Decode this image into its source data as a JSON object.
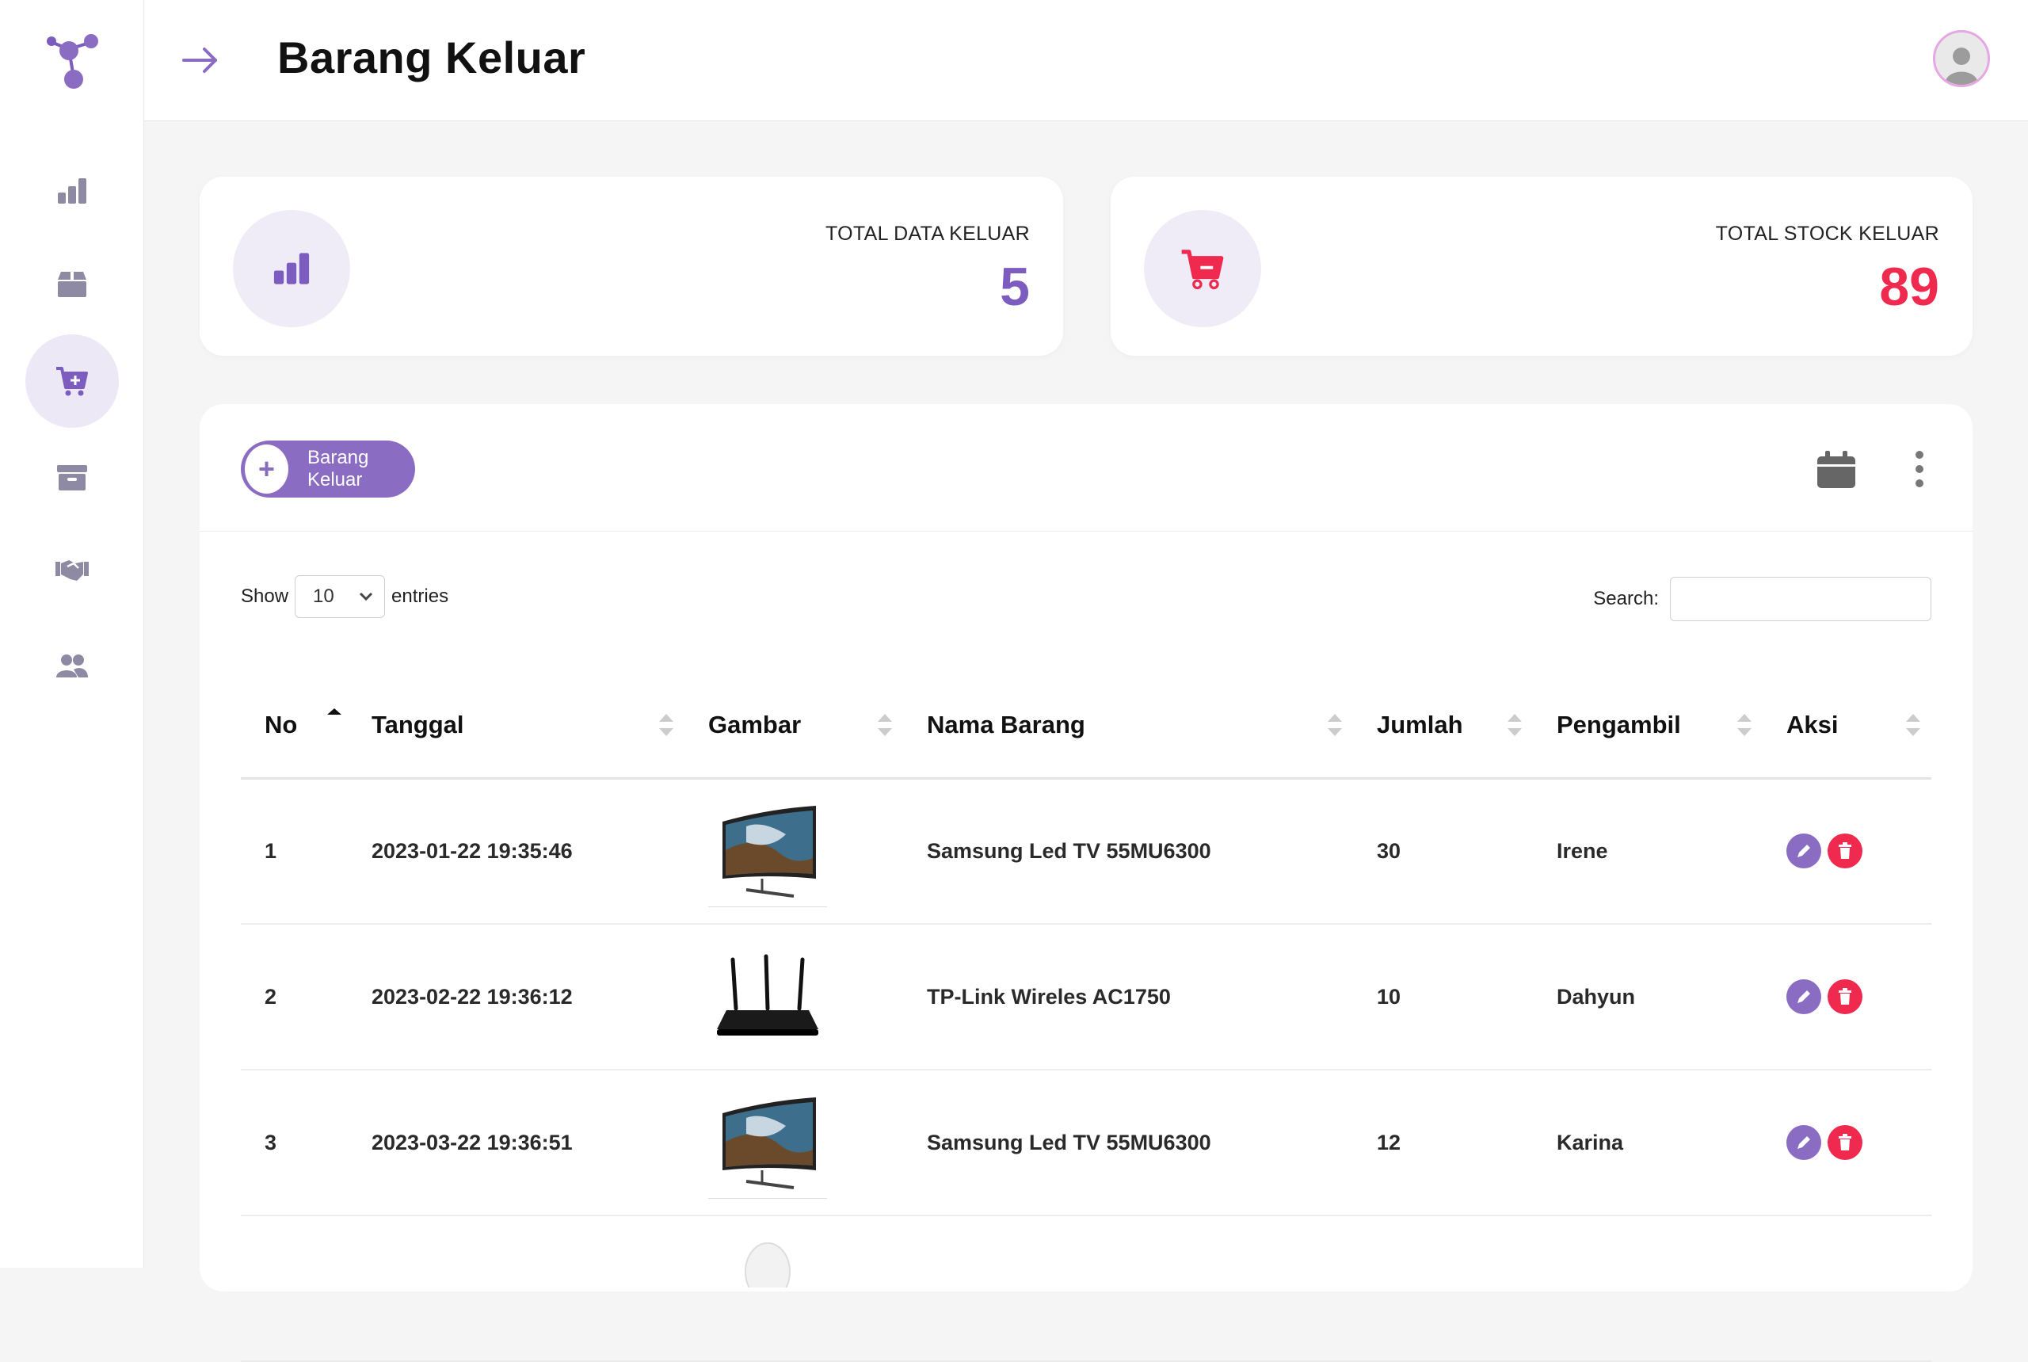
{
  "header": {
    "title": "Barang Keluar"
  },
  "sidebar": {
    "items": [
      {
        "icon": "chart-bar-icon"
      },
      {
        "icon": "box-icon"
      },
      {
        "icon": "cart-plus-icon",
        "active": true
      },
      {
        "icon": "archive-icon"
      },
      {
        "icon": "handshake-icon"
      },
      {
        "icon": "users-icon"
      }
    ]
  },
  "stats": [
    {
      "label": "TOTAL DATA KELUAR",
      "value": "5",
      "color": "#7c5cbf",
      "icon": "chart-bar-icon"
    },
    {
      "label": "TOTAL STOCK KELUAR",
      "value": "89",
      "color": "#ef2a4e",
      "icon": "cart-minus-icon"
    }
  ],
  "toolbar": {
    "add_label": "Barang Keluar",
    "add_symbol": "+"
  },
  "table_controls": {
    "show_label": "Show",
    "entries_value": "10",
    "entries_label": "entries",
    "search_label": "Search:",
    "search_value": ""
  },
  "table": {
    "columns": [
      "No",
      "Tanggal",
      "Gambar",
      "Nama Barang",
      "Jumlah",
      "Pengambil",
      "Aksi"
    ],
    "rows": [
      {
        "no": "1",
        "tanggal": "2023-01-22 19:35:46",
        "gambar": "tv",
        "nama": "Samsung Led TV 55MU6300",
        "jumlah": "30",
        "pengambil": "Irene"
      },
      {
        "no": "2",
        "tanggal": "2023-02-22 19:36:12",
        "gambar": "router",
        "nama": "TP-Link Wireles AC1750",
        "jumlah": "10",
        "pengambil": "Dahyun"
      },
      {
        "no": "3",
        "tanggal": "2023-03-22 19:36:51",
        "gambar": "tv",
        "nama": "Samsung Led TV 55MU6300",
        "jumlah": "12",
        "pengambil": "Karina"
      },
      {
        "no": "",
        "tanggal": "",
        "gambar": "mouse",
        "nama": "",
        "jumlah": "",
        "pengambil": ""
      }
    ]
  },
  "colors": {
    "accent": "#8a6cc2",
    "danger": "#ef2a4e",
    "sidebar_icon": "#8f8aa3"
  }
}
